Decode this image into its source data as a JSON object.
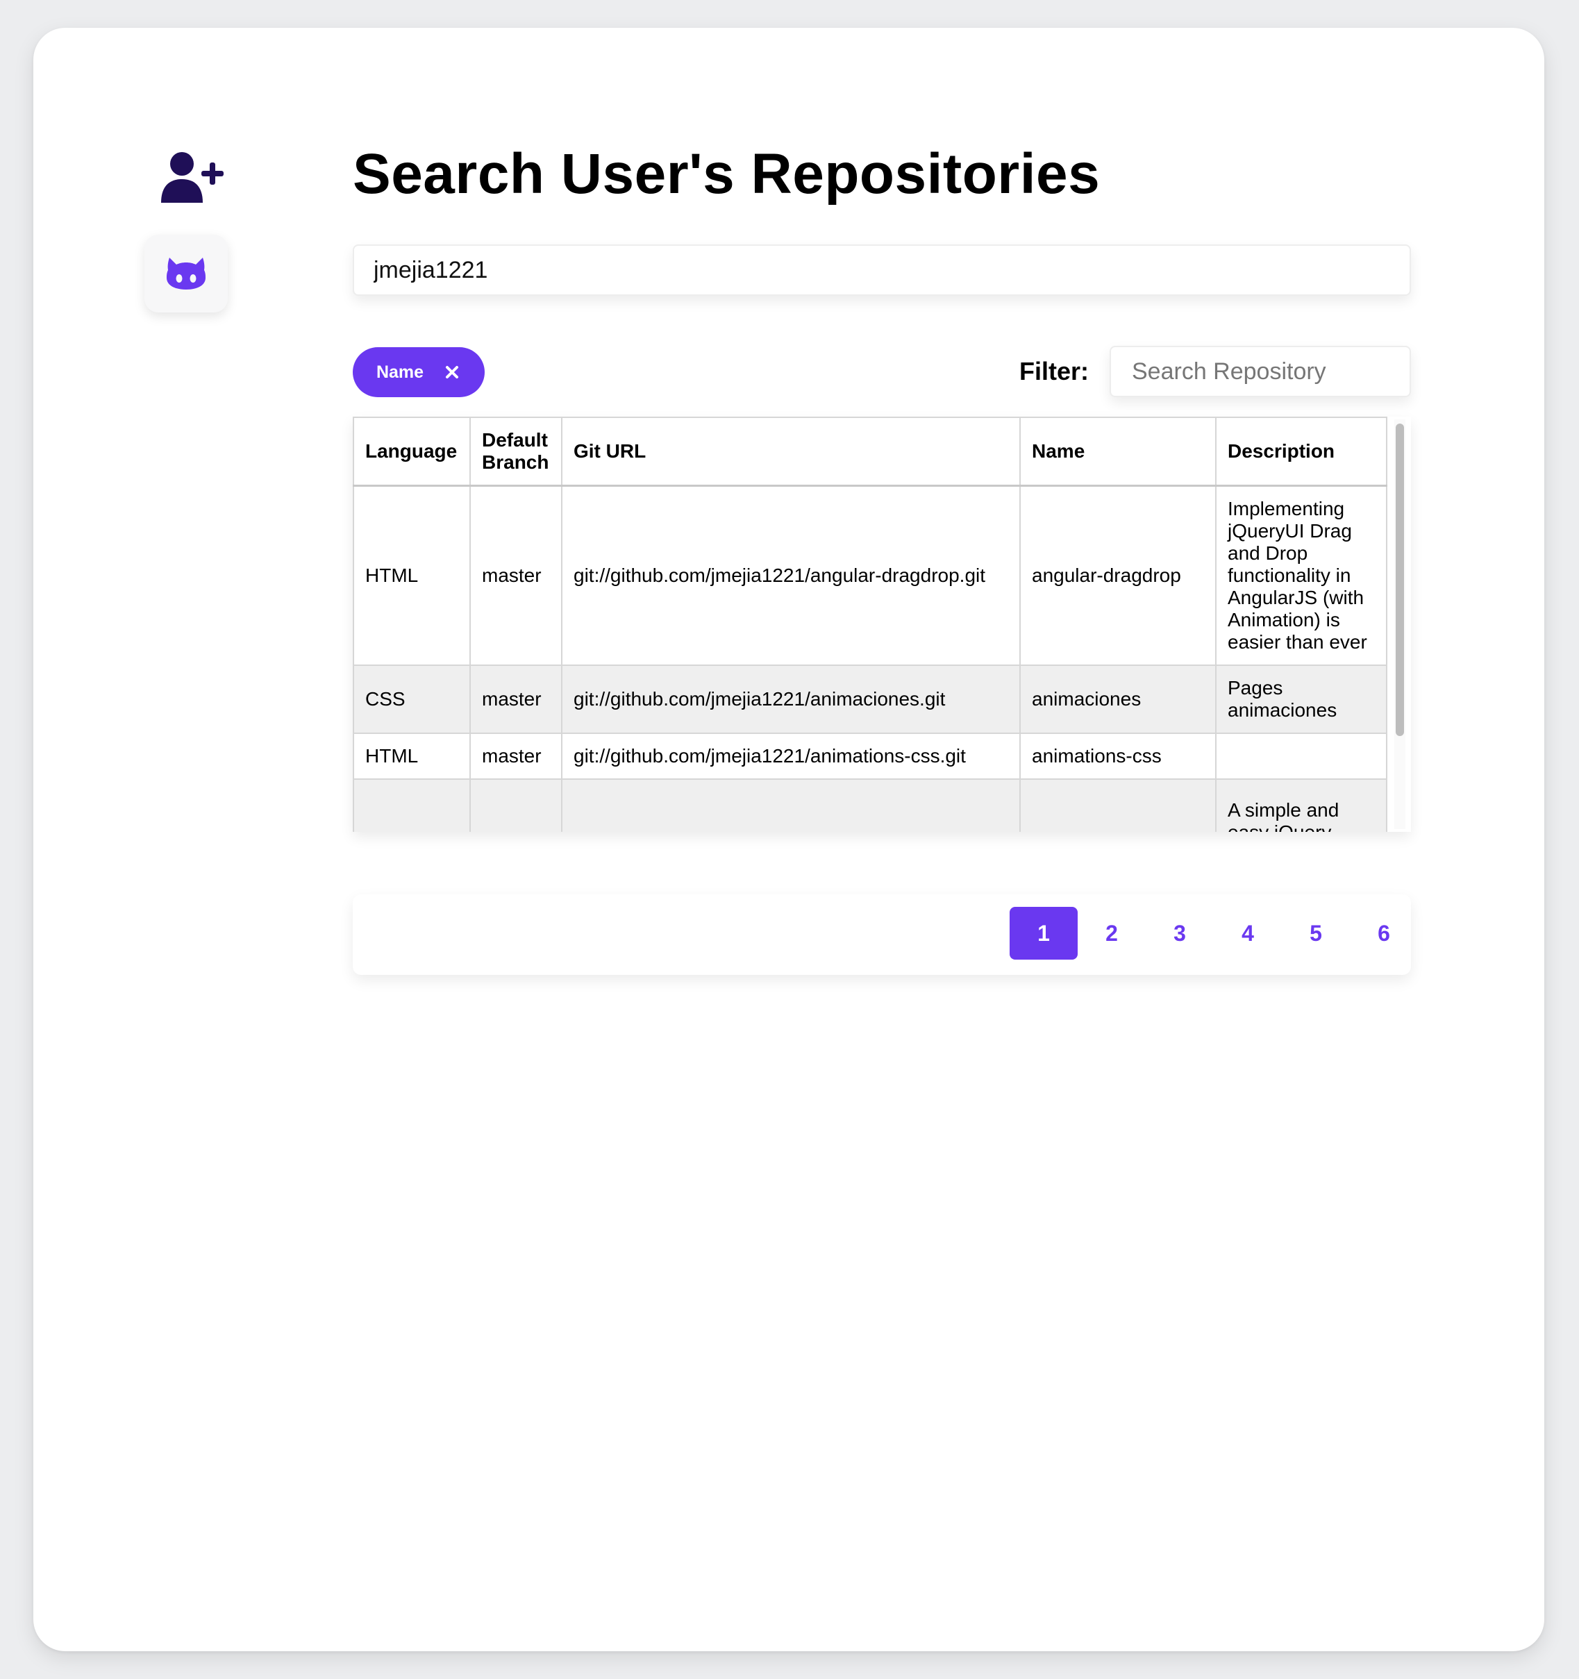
{
  "sidebar": {
    "add_user_icon": "user-plus-icon",
    "github_icon": "github-icon"
  },
  "header": {
    "title": "Search User's Repositories"
  },
  "user_search": {
    "value": "jmejia1221"
  },
  "chips": [
    {
      "label": "Name",
      "icon": "close-icon"
    }
  ],
  "filter": {
    "label": "Filter:",
    "placeholder": "Search Repository"
  },
  "table": {
    "columns": [
      "Language",
      "Default Branch",
      "Git URL",
      "Name",
      "Description"
    ],
    "rows": [
      [
        "HTML",
        "master",
        "git://github.com/jmejia1221/angular-dragdrop.git",
        "angular-dragdrop",
        "Implementing jQueryUI Drag and Drop functionality in AngularJS (with Animation) is easier than ever"
      ],
      [
        "CSS",
        "master",
        "git://github.com/jmejia1221/animaciones.git",
        "animaciones",
        "Pages animaciones"
      ],
      [
        "HTML",
        "master",
        "git://github.com/jmejia1221/animations-css.git",
        "animations-css",
        ""
      ],
      [
        "",
        "",
        "",
        "",
        "A simple and easy jQuery"
      ]
    ]
  },
  "pagination": {
    "pages": [
      "1",
      "2",
      "3",
      "4",
      "5",
      "6"
    ],
    "active": "1"
  },
  "colors": {
    "accent": "#6a38f0",
    "icon_dark": "#1f0f57",
    "background": "#ecedef"
  }
}
